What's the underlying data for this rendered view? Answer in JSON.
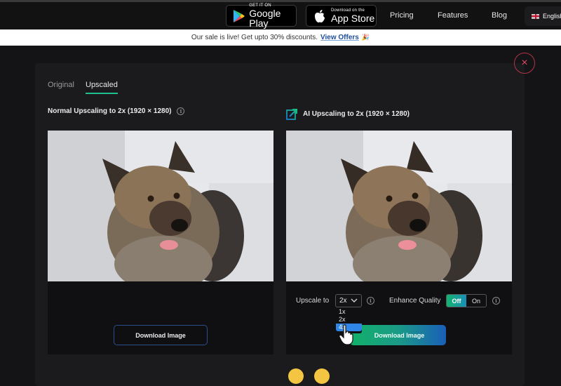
{
  "navbar": {
    "google_play": {
      "small": "GET IT ON",
      "big": "Google Play"
    },
    "app_store": {
      "small": "Download on the",
      "big": "App Store"
    },
    "links": [
      "Pricing",
      "Features",
      "Blog"
    ],
    "language": "English"
  },
  "sale_banner": {
    "text": "Our sale is live! Get upto 30% discounts.",
    "link": "View Offers",
    "emoji": "🎉"
  },
  "modal": {
    "close_label": "×",
    "tabs": [
      {
        "label": "Original",
        "active": false
      },
      {
        "label": "Upscaled",
        "active": true
      }
    ],
    "left_panel": {
      "title": "Normal Upscaling to 2x (1920 × 1280)",
      "info": "i",
      "download_label": "Download Image"
    },
    "right_panel": {
      "title": "AI Upscaling to 2x (1920 × 1280)",
      "upscale_label": "Upscale to",
      "upscale_value": "2x",
      "upscale_options": [
        "1x",
        "2x",
        "4x"
      ],
      "highlighted_option": "4x",
      "info": "i",
      "enhance_label": "Enhance Quality",
      "toggle_off": "Off",
      "toggle_on": "On",
      "toggle_state": "Off",
      "download_label": "Download Image"
    }
  },
  "colors": {
    "accent_green": "#1fbf8f",
    "close_red": "#e04a62",
    "link_blue": "#1f4f9c",
    "highlight_blue": "#2f86e6"
  }
}
